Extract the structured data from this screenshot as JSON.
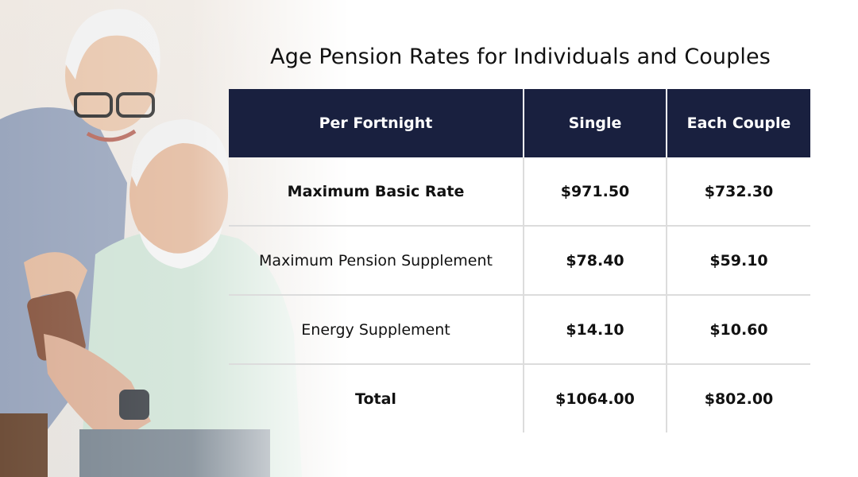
{
  "title": "Age Pension Rates for Individuals and Couples",
  "table": {
    "headers": [
      "Per Fortnight",
      "Single",
      "Each Couple"
    ],
    "rows": [
      {
        "label": "Maximum Basic Rate",
        "single": "$971.50",
        "couple": "$732.30"
      },
      {
        "label": "Maximum Pension Supplement",
        "single": "$78.40",
        "couple": "$59.10"
      },
      {
        "label": "Energy Supplement",
        "single": "$14.10",
        "couple": "$10.60"
      },
      {
        "label": "Total",
        "single": "$1064.00",
        "couple": "$802.00"
      }
    ]
  },
  "colors": {
    "header_bg": "#19203f",
    "header_text": "#ffffff",
    "grid": "#dcdcdc"
  }
}
